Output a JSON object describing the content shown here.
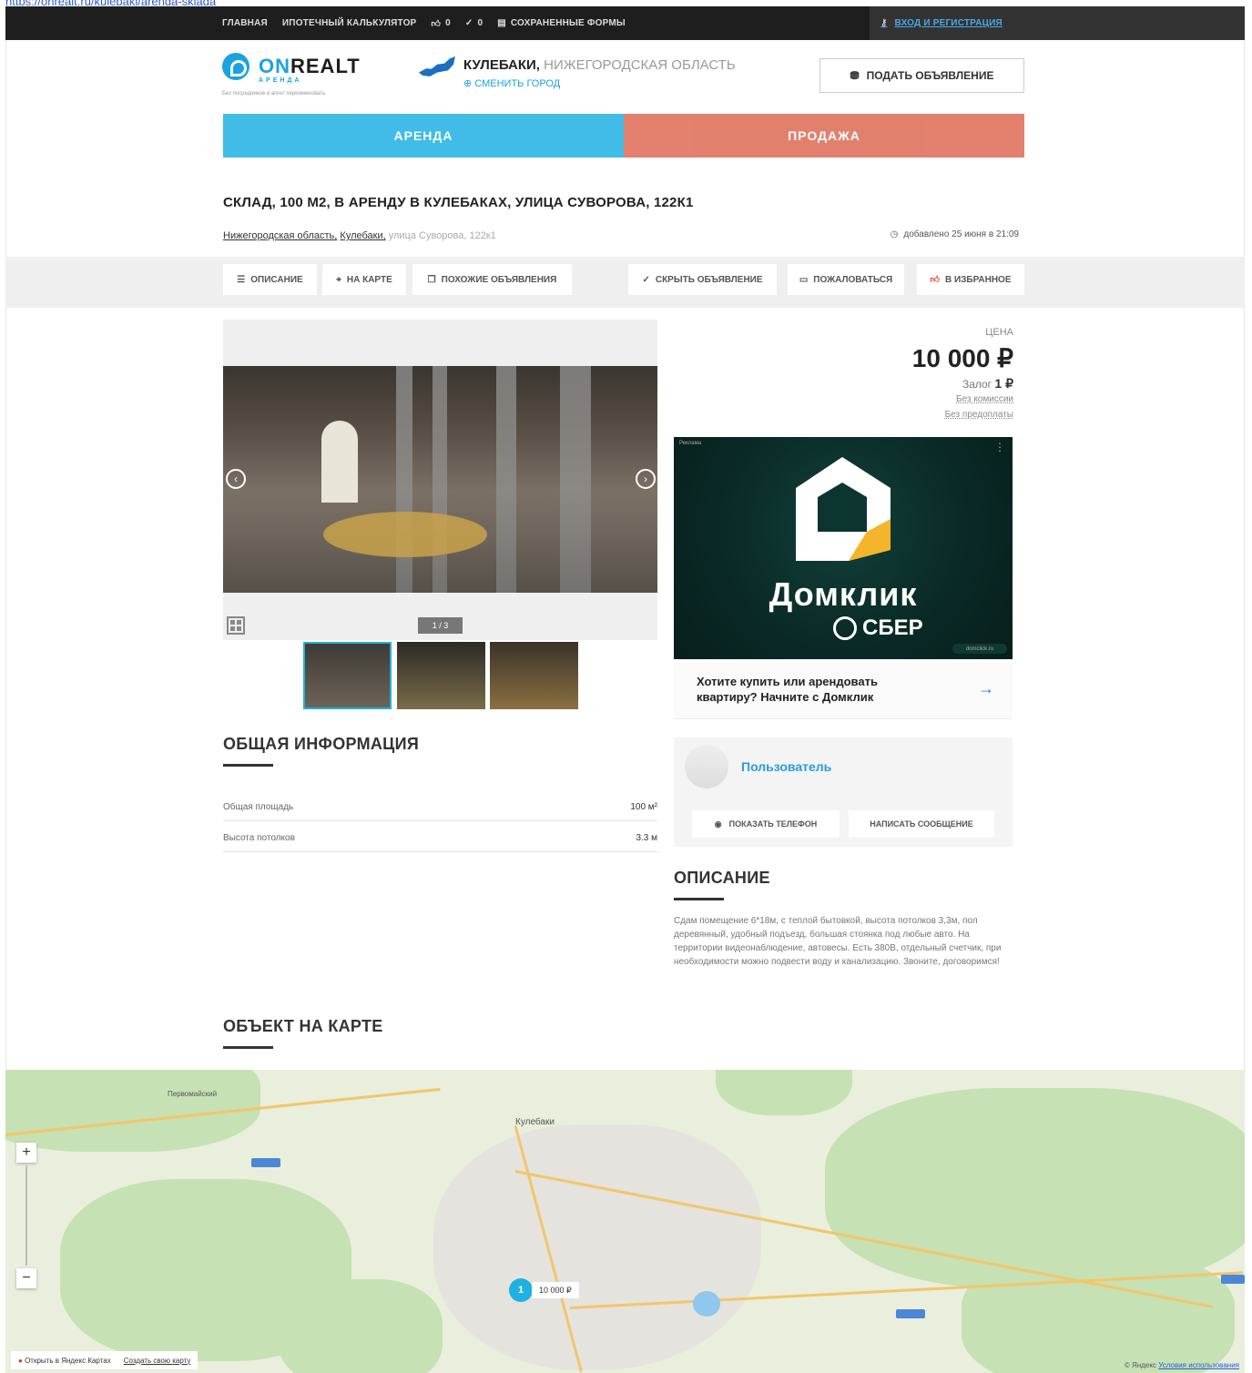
{
  "header": {
    "nav": [
      {
        "label": "ГЛАВНАЯ",
        "icon": null
      },
      {
        "label": "ИПОТЕЧНЫЙ КАЛЬКУЛЯТОР",
        "icon": null
      },
      {
        "label": "0",
        "icon": "thumbs-up-icon"
      },
      {
        "label": "0",
        "icon": "check-icon"
      },
      {
        "label": "СОХРАНЕННЫЕ ФОРМЫ",
        "icon": "save-icon"
      }
    ],
    "login_label": "ВХОД И РЕГИСТРАЦИЯ"
  },
  "logo": {
    "name_accent": "ON",
    "name_rest": "REALT",
    "sub": "АРЕНДА",
    "tagline": "Без посредников и агент переименовать"
  },
  "city": {
    "name": "КУЛЕБАКИ,",
    "region": "НИЖЕГОРОДСКАЯ ОБЛАСТЬ",
    "change": "СМЕНИТЬ ГОРОД"
  },
  "post_button": "ПОДАТЬ ОБЪЯВЛЕНИЕ",
  "tabs": {
    "rent": "АРЕНДА",
    "sale": "ПРОДАЖА"
  },
  "listing": {
    "title": "СКЛАД, 100 М2, В АРЕНДУ В КУЛЕБАКАХ, УЛИЦА СУВОРОВА, 122К1",
    "breadcrumb_region": "Нижегородская область,",
    "breadcrumb_city": "Кулебаки,",
    "breadcrumb_street": "улица Суворова, 122к1",
    "added": "добавлено 25 июня в 21:09"
  },
  "actions": {
    "description": "ОПИСАНИЕ",
    "on_map": "НА КАРТЕ",
    "similar": "ПОХОЖИЕ ОБЪЯВЛЕНИЯ",
    "hide": "СКРЫТЬ ОБЪЯВЛЕНИЕ",
    "complain": "ПОЖАЛОВАТЬСЯ",
    "favorite": "В ИЗБРАННОЕ"
  },
  "gallery": {
    "counter": "1 / 3"
  },
  "general_info": {
    "heading": "ОБЩАЯ ИНФОРМАЦИЯ",
    "rows": [
      {
        "label": "Общая площадь",
        "value": "100 м²"
      },
      {
        "label": "Высота потолков",
        "value": "3.3 м"
      }
    ]
  },
  "price": {
    "label": "ЦЕНА",
    "value": "10 000 ₽",
    "deposit_label": "Залог",
    "deposit_value": "1 ₽",
    "no_commission": "Без комиссии",
    "no_prepay": "Без предоплаты"
  },
  "ad": {
    "brand": "Домклик",
    "sber": "СБЕР",
    "text": "Хотите купить или арендовать квартиру? Начните с Домклик",
    "arrow": "→",
    "label": "Реклама",
    "corner": "domclick.ru"
  },
  "seller": {
    "name": "Пользователь",
    "show_phone": "ПОКАЗАТЬ ТЕЛЕФОН",
    "write": "НАПИСАТЬ СООБЩЕНИЕ"
  },
  "description": {
    "heading": "ОПИСАНИЕ",
    "text": "Сдам помещение 6*18м, с теплой бытовкой, высота потолков 3,3м, пол деревянный, удобный подъезд, большая стоянка под любые авто. На территории видеонаблюдение, автовесы. Есть 380В, отдельный счетчик, при необходимости можно подвести воду и канализацию. Звоните, договоримся!"
  },
  "map": {
    "heading": "ОБЪЕКТ НА КАРТЕ",
    "pin_count": "1",
    "pin_price": "10 000 ₽",
    "city_label": "Кулебаки",
    "village_label": "Первомайский",
    "open_yandex": "Открыть в Яндекс Картах",
    "create_map": "Создать свою карту",
    "copyright": "© Яндекс",
    "terms": "Условия использования"
  }
}
